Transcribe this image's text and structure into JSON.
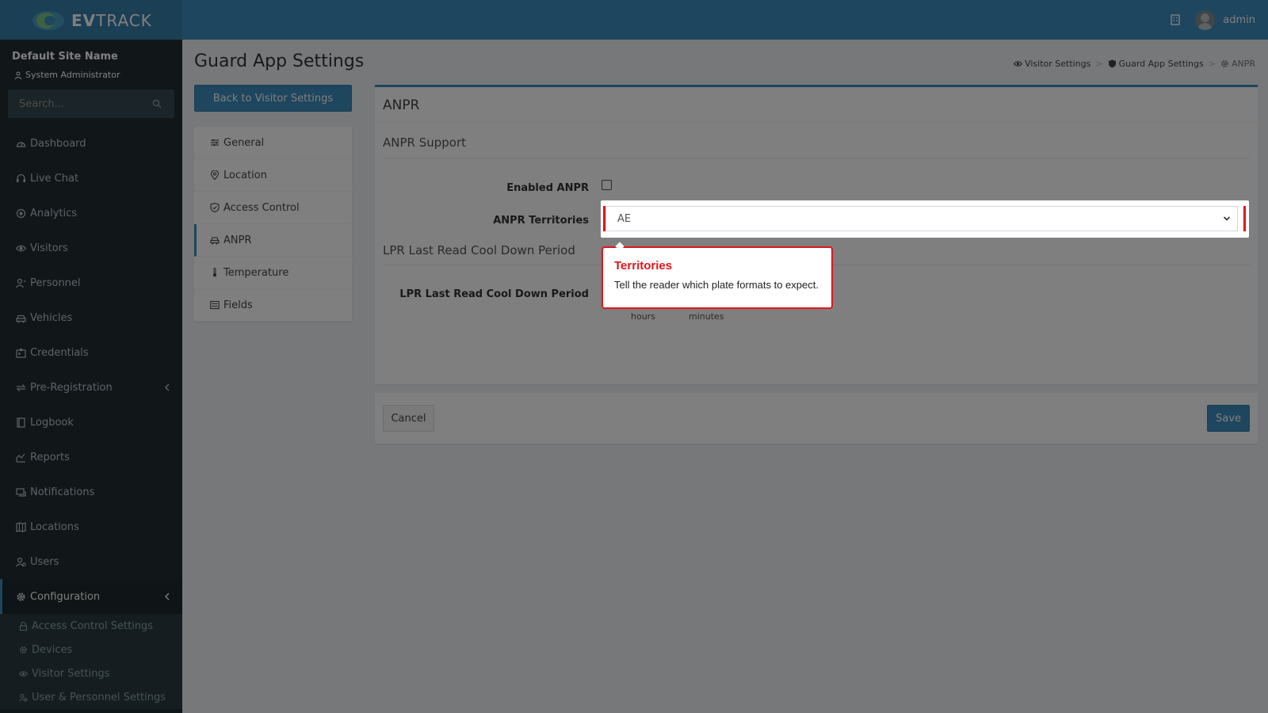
{
  "app": {
    "logo_bold": "EV",
    "logo_rest": "TRACK",
    "user_name": "admin"
  },
  "sidebar": {
    "site_name": "Default Site Name",
    "role": "System Administrator",
    "search_placeholder": "Search...",
    "items": [
      {
        "label": "Dashboard",
        "icon": "dashboard-icon"
      },
      {
        "label": "Live Chat",
        "icon": "headset-icon"
      },
      {
        "label": "Analytics",
        "icon": "analytics-icon"
      },
      {
        "label": "Visitors",
        "icon": "eye-icon"
      },
      {
        "label": "Personnel",
        "icon": "personnel-icon"
      },
      {
        "label": "Vehicles",
        "icon": "car-icon"
      },
      {
        "label": "Credentials",
        "icon": "id-card-icon"
      },
      {
        "label": "Pre-Registration",
        "icon": "exchange-icon"
      },
      {
        "label": "Logbook",
        "icon": "book-icon"
      },
      {
        "label": "Reports",
        "icon": "reports-icon"
      },
      {
        "label": "Notifications",
        "icon": "notifications-icon"
      },
      {
        "label": "Locations",
        "icon": "map-icon"
      },
      {
        "label": "Users",
        "icon": "users-icon"
      },
      {
        "label": "Configuration",
        "icon": "gear-icon"
      }
    ],
    "sub_items": [
      {
        "label": "Access Control Settings",
        "icon": "lock-icon"
      },
      {
        "label": "Devices",
        "icon": "cog-icon"
      },
      {
        "label": "Visitor Settings",
        "icon": "eye-icon"
      },
      {
        "label": "User & Personnel Settings",
        "icon": "users-icon"
      }
    ]
  },
  "page": {
    "title": "Guard App Settings",
    "breadcrumb": [
      "Visitor Settings",
      "Guard App Settings",
      "ANPR"
    ],
    "breadcrumb_sep": ">",
    "back_button": "Back to Visitor Settings"
  },
  "settings_menu": [
    {
      "label": "General",
      "icon": "sliders-icon"
    },
    {
      "label": "Location",
      "icon": "location-pin-icon"
    },
    {
      "label": "Access Control",
      "icon": "shield-icon"
    },
    {
      "label": "ANPR",
      "icon": "car-icon",
      "active": true
    },
    {
      "label": "Temperature",
      "icon": "thermometer-icon"
    },
    {
      "label": "Fields",
      "icon": "fields-icon"
    }
  ],
  "anpr": {
    "box_title": "ANPR",
    "section_support": "ANPR Support",
    "enabled_label": "Enabled ANPR",
    "enabled_checked": false,
    "territories_label": "ANPR Territories",
    "territories_value": "AE",
    "section_cooldown": "LPR Last Read Cool Down Period",
    "cooldown_label": "LPR Last Read Cool Down Period",
    "unit_hours": "hours",
    "unit_minutes": "minutes"
  },
  "footer": {
    "cancel": "Cancel",
    "save": "Save"
  },
  "tooltip": {
    "title": "Territories",
    "text": "Tell the reader which plate formats to expect."
  },
  "colors": {
    "primary": "#3c8dbc",
    "sidebar": "#222d32",
    "highlight": "#e0161b"
  }
}
